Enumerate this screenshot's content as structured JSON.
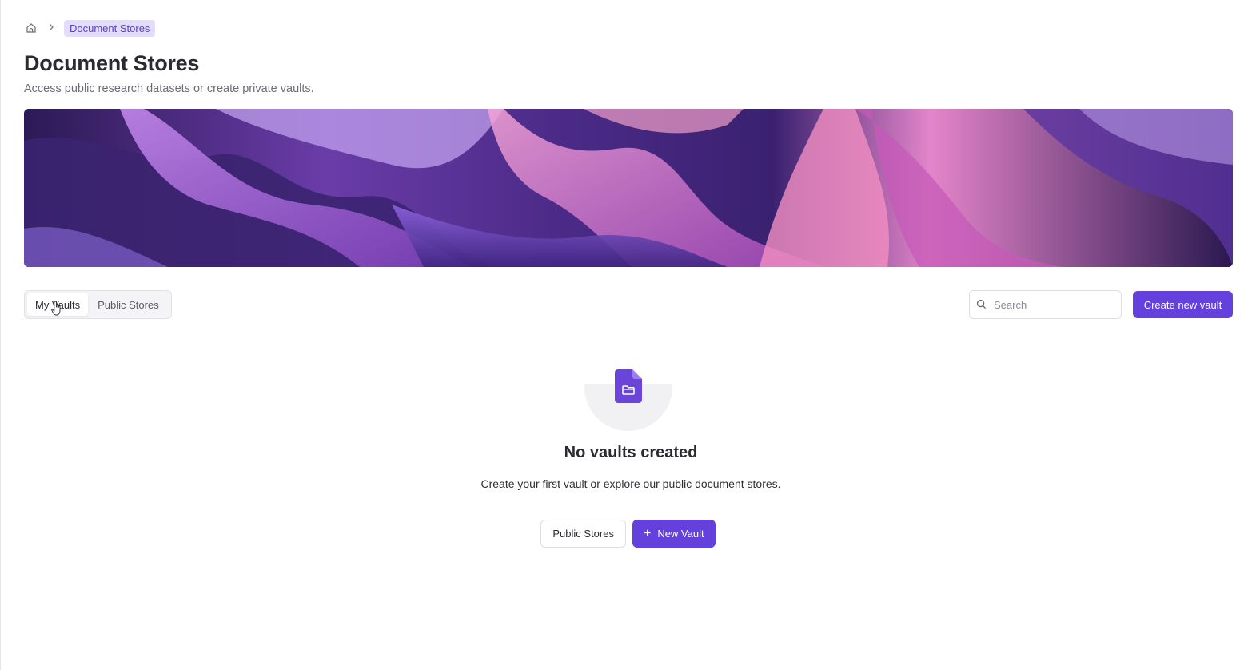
{
  "breadcrumb": {
    "home_icon": "home-icon",
    "separator_icon": "chevron-right-icon",
    "current": "Document Stores"
  },
  "header": {
    "title": "Document Stores",
    "subtitle": "Access public research datasets or create private vaults."
  },
  "tabs": [
    {
      "label": "My Vaults",
      "active": true
    },
    {
      "label": "Public Stores",
      "active": false
    }
  ],
  "search": {
    "placeholder": "Search",
    "value": ""
  },
  "toolbar": {
    "create_label": "Create new vault"
  },
  "empty_state": {
    "icon": "folder-document-icon",
    "title": "No vaults created",
    "text": "Create your first vault or explore our public document stores.",
    "secondary_action": "Public Stores",
    "primary_action": "New Vault"
  },
  "colors": {
    "accent": "#6440dc",
    "accent_light": "#e3dcfb",
    "banner_dark": "#3a2468",
    "banner_pink": "#e58ad8"
  }
}
